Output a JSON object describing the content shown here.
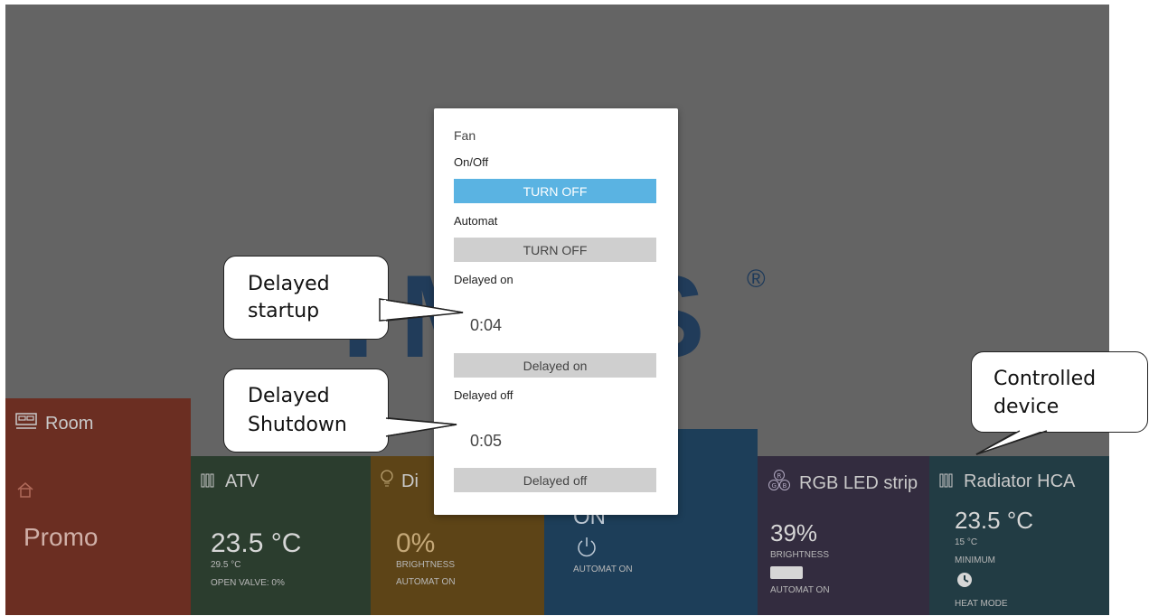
{
  "logo": {
    "text": "IMPS",
    "reg": "®"
  },
  "tiles": {
    "room": {
      "title": "Room",
      "value": "Promo",
      "icon": "bed-icon",
      "sub_icon": "home-icon"
    },
    "atv": {
      "title": "ATV",
      "value": "23.5 °C",
      "line1": "29.5 °C",
      "line2": "OPEN VALVE: 0%",
      "icon": "radiator-icon"
    },
    "dimmer": {
      "title": "Di",
      "value": "0%",
      "line1": "BRIGHTNESS",
      "line2": "AUTOMAT ON",
      "icon": "bulb-icon"
    },
    "fan": {
      "value": "ON",
      "line1": "AUTOMAT ON",
      "icon": "power-icon"
    },
    "rgb": {
      "title": "RGB LED strip",
      "value": "39%",
      "line1": "BRIGHTNESS",
      "line2": "AUTOMAT ON",
      "icon": "rgb-icon"
    },
    "radiator": {
      "title": "Radiator HCA",
      "value": "23.5 °C",
      "line1": "15 °C",
      "line2": "MINIMUM",
      "line3": "HEAT MODE",
      "icon": "radiator-icon"
    }
  },
  "modal": {
    "title": "Fan",
    "onoff_label": "On/Off",
    "onoff_button": "TURN OFF",
    "automat_label": "Automat",
    "automat_button": "TURN OFF",
    "delayed_on_label": "Delayed on",
    "delayed_on_time": "0:04",
    "delayed_on_button": "Delayed on",
    "delayed_off_label": "Delayed off",
    "delayed_off_time": "0:05",
    "delayed_off_button": "Delayed off"
  },
  "callouts": {
    "startup": [
      "Delayed",
      "startup"
    ],
    "shutdown": [
      "Delayed",
      "Shutdown"
    ],
    "device": [
      "Controlled",
      "device"
    ]
  },
  "colors": {
    "backdrop": "#646464",
    "primary_button": "#5ab3e2",
    "secondary_button": "#cfcfcf",
    "room_tile": "#6b2e22",
    "atv_tile": "#2b3d2e",
    "dimmer_tile": "#5d4417",
    "fan_tile": "#1d3e59",
    "rgb_tile": "#332c3f",
    "radiator_tile": "#223c44"
  }
}
